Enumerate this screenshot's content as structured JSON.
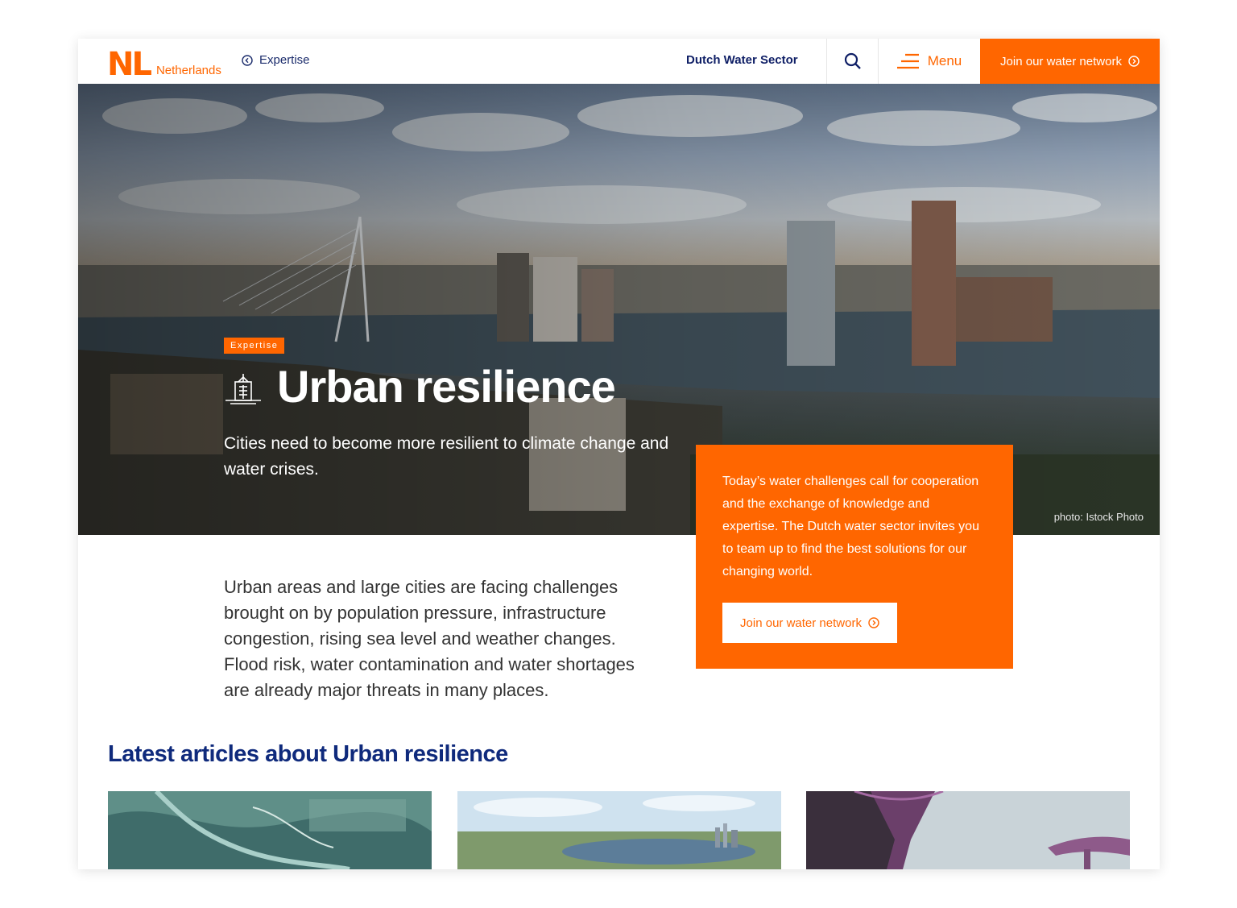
{
  "header": {
    "logo_mark": "NL",
    "logo_text": "Netherlands",
    "breadcrumb": "Expertise",
    "nav_link": "Dutch Water Sector",
    "menu_label": "Menu",
    "join_label": "Join our water network",
    "accent": "#ff6600",
    "navy": "#0f1f66"
  },
  "hero": {
    "tag": "Expertise",
    "title": "Urban resilience",
    "subtitle": "Cities need to become more resilient to climate change and water crises.",
    "photo_credit": "photo: Istock Photo"
  },
  "cta_box": {
    "text": "Today’s water challenges call for coopera­tion and the exchange of knowledge and expertise. The Dutch water sector invites you to team up to find the best solutions for our changing world.",
    "button": "Join our water network"
  },
  "intro": "Urban areas and large cities are facing challenges brought on by population pressure, infrastructure congestion, rising sea level and weather changes. Flood risk, water contamination and water short­ages are already major threats in many places.",
  "articles": {
    "heading": "Latest articles about Urban resilience"
  },
  "icons": {
    "breadcrumb": "chevron-left-circle-icon",
    "search": "search-icon",
    "menu": "menu-icon",
    "arrow": "arrow-right-circle-icon",
    "hero": "building-icon"
  }
}
